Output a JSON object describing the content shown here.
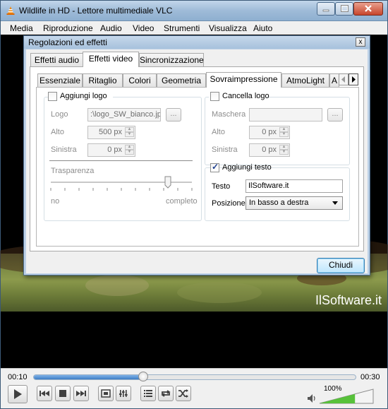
{
  "window": {
    "title": "Wildlife in HD - Lettore multimediale VLC"
  },
  "menubar": {
    "items": [
      "Media",
      "Riproduzione",
      "Audio",
      "Video",
      "Strumenti",
      "Visualizza",
      "Aiuto"
    ]
  },
  "video": {
    "watermark": "IlSoftware.it"
  },
  "dialog": {
    "title": "Regolazioni ed effetti",
    "close_glyph": "x",
    "main_tabs": [
      "Effetti audio",
      "Effetti video",
      "Sincronizzazione"
    ],
    "active_main_tab": "Effetti video",
    "sub_tabs": [
      "Essenziale",
      "Ritaglio",
      "Colori",
      "Geometria",
      "Sovraimpressione",
      "AtmoLight",
      "A"
    ],
    "active_sub_tab": "Sovraimpressione",
    "logo": {
      "checkbox_label": "Aggiungi logo",
      "checked": false,
      "logo_label": "Logo",
      "logo_value": ":\\logo_SW_bianco.jpg",
      "browse_label": "...",
      "top_label": "Alto",
      "top_value": "500 px",
      "left_label": "Sinistra",
      "left_value": "0 px",
      "transparency_label": "Trasparenza",
      "slider_min_label": "no",
      "slider_max_label": "completo",
      "transparency_level": 0.83
    },
    "erase": {
      "checkbox_label": "Cancella logo",
      "checked": false,
      "mask_label": "Maschera",
      "mask_value": "",
      "browse_label": "...",
      "top_label": "Alto",
      "top_value": "0 px",
      "left_label": "Sinistra",
      "left_value": "0 px"
    },
    "text": {
      "checkbox_label": "Aggiungi testo",
      "checked": true,
      "text_label": "Testo",
      "text_value": "IlSoftware.it",
      "position_label": "Posizione",
      "position_value": "In basso a destra"
    },
    "close_button": "Chiudi"
  },
  "controls": {
    "time_elapsed": "00:10",
    "time_total": "00:30",
    "progress": 0.34,
    "volume_label": "100%",
    "volume_level": 1.0,
    "buttons": [
      "play-icon",
      "previous-icon",
      "stop-icon",
      "next-icon",
      "fullscreen-icon",
      "equalizer-icon",
      "playlist-icon",
      "loop-icon",
      "shuffle-icon",
      "speaker-icon"
    ]
  }
}
